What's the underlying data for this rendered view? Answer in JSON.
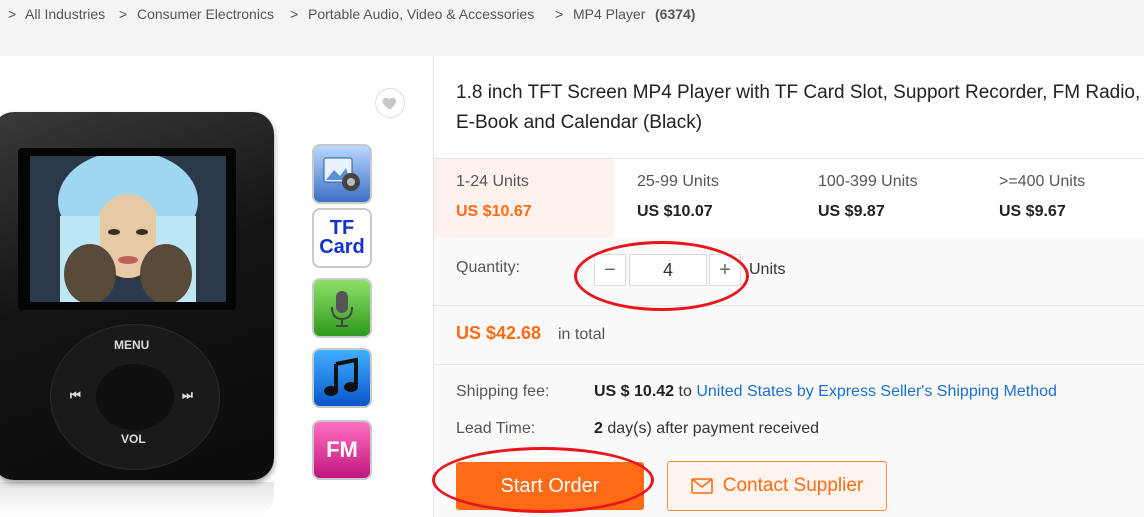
{
  "breadcrumb": {
    "items": [
      {
        "label": "All Industries",
        "sep": ">"
      },
      {
        "label": "Consumer Electronics",
        "sep": ">"
      },
      {
        "label": "Portable Audio, Video & Accessories",
        "sep": ">"
      },
      {
        "label": "MP4 Player",
        "sep": ">"
      }
    ],
    "count": "(6374)"
  },
  "product": {
    "title": "1.8 inch TFT Screen MP4 Player with TF Card Slot, Support Recorder, FM Radio, E-Book and Calendar (Black)",
    "device_labels": {
      "menu": "MENU",
      "vol": "VOL"
    },
    "feature_icons": [
      {
        "name": "photo-icon"
      },
      {
        "name": "tf-card-icon",
        "text_line1": "TF",
        "text_line2": "Card"
      },
      {
        "name": "microphone-icon"
      },
      {
        "name": "music-note-icon"
      },
      {
        "name": "fm-radio-icon",
        "text": "FM"
      }
    ]
  },
  "pricing": {
    "tiers": [
      {
        "units": "1-24 Units",
        "price": "US $10.67",
        "active": true
      },
      {
        "units": "25-99 Units",
        "price": "US $10.07",
        "active": false
      },
      {
        "units": "100-399 Units",
        "price": "US $9.87",
        "active": false
      },
      {
        "units": ">=400 Units",
        "price": "US $9.67",
        "active": false
      }
    ]
  },
  "quantity": {
    "label": "Quantity:",
    "minus": "−",
    "plus": "+",
    "value": "4",
    "unit": "Units"
  },
  "total": {
    "amount": "US $42.68",
    "suffix": "in total"
  },
  "shipping": {
    "label": "Shipping fee:",
    "fee": "US $ 10.42",
    "to": "to",
    "link": "United States by Express Seller's Shipping Method"
  },
  "lead_time": {
    "label": "Lead Time:",
    "days": "2",
    "suffix": "day(s) after payment received"
  },
  "actions": {
    "start_order": "Start Order",
    "contact_supplier": "Contact Supplier"
  },
  "colors": {
    "accent": "#ff6a14",
    "link": "#1a6fd0",
    "annotation": "#e8161c"
  }
}
